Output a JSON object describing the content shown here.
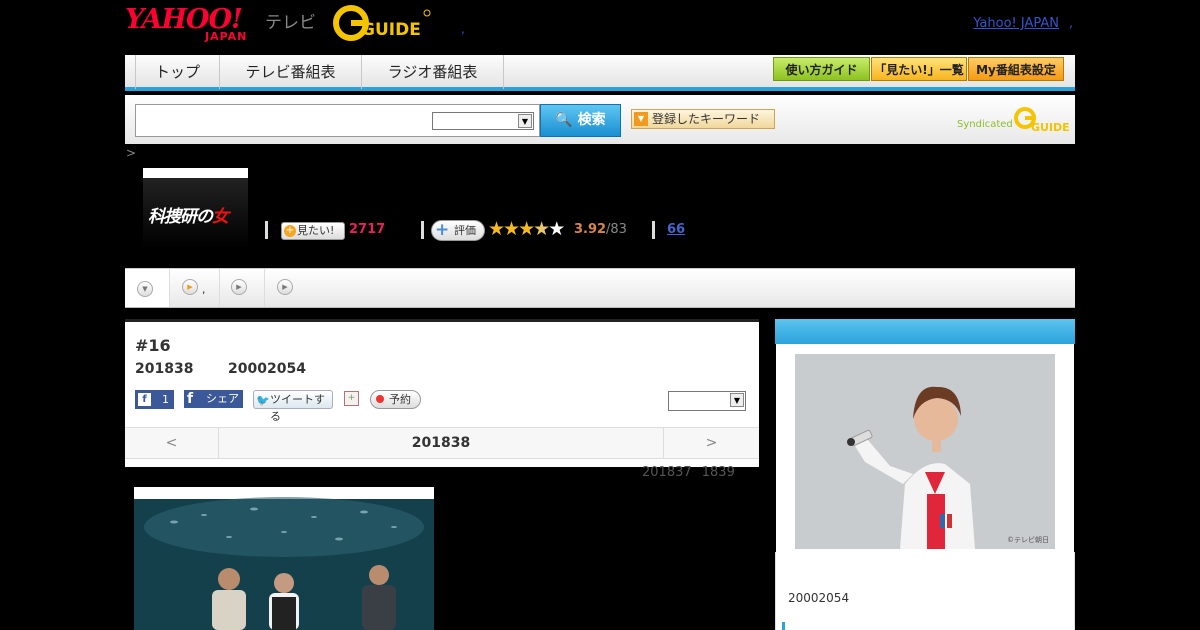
{
  "header": {
    "yahoo_logo": "YAHOO!",
    "yahoo_sub": "JAPAN",
    "tv_label": "テレビ",
    "gguide_logo": "GUIDE",
    "dot": ",",
    "yahoo_japan_link": "Yahoo! JAPAN",
    "dot2": ","
  },
  "nav": {
    "tabs": [
      {
        "label": "トップ"
      },
      {
        "label": "テレビ番組表"
      },
      {
        "label": "ラジオ番組表"
      }
    ],
    "buttons": [
      {
        "label": "使い方ガイド"
      },
      {
        "label": "「見たい!」一覧"
      },
      {
        "label": "My番組表設定"
      }
    ]
  },
  "search": {
    "input_value": "",
    "select_value": "",
    "button_label": "検索",
    "keyword_button": "登録したキーワード",
    "syndicated_label": "Syndicated",
    "gguide_small": "GUIDE"
  },
  "breadcrumb": ">",
  "program": {
    "thumb_title_a": "科捜研の",
    "thumb_title_b": "女",
    "mitai_label": "見たい!",
    "mitai_count": "2717",
    "eval_label": "評価",
    "rating_value": 3.92,
    "rating_text": "3.92",
    "rating_of": "/83",
    "review_count": "66"
  },
  "episode_tabs": {
    "comma": ","
  },
  "episode": {
    "number": "#16",
    "date": "201838",
    "program_id": "20002054",
    "fb_like_count": "1",
    "fb_share_label": "シェア",
    "tweet_label": "ツイートする",
    "reserve_label": "予約",
    "select_value": "",
    "pager_prev": "<",
    "pager_current": "201838",
    "pager_next": ">"
  },
  "episode_meta": "201837 1839",
  "sidebar": {
    "copyright": "©テレビ朝日",
    "program_id": "20002054"
  },
  "colors": {
    "accent": "#2aa3dc",
    "mitai_count": "#e4235a",
    "star": "#f5b921",
    "score": "#d9864a",
    "link": "#4466cc"
  }
}
